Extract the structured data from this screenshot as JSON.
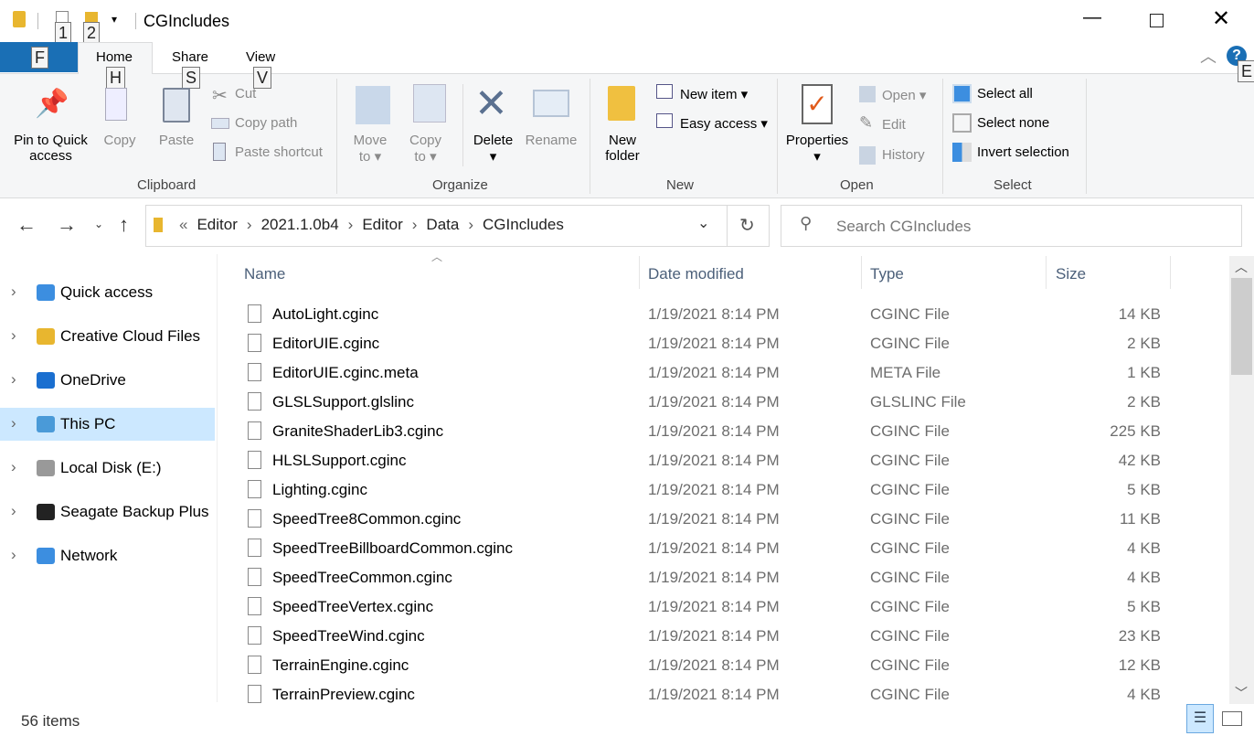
{
  "window": {
    "title": "CGIncludes",
    "qat_keys": [
      "1",
      "2"
    ]
  },
  "tabs": [
    {
      "label": "File",
      "key": "F"
    },
    {
      "label": "Home",
      "key": "H"
    },
    {
      "label": "Share",
      "key": "S"
    },
    {
      "label": "View",
      "key": "V"
    }
  ],
  "help_key": "E",
  "ribbon": {
    "clipboard": {
      "pin": "Pin to Quick access",
      "pin_l1": "Pin to Quick",
      "pin_l2": "access",
      "copy": "Copy",
      "paste": "Paste",
      "cut": "Cut",
      "copy_path": "Copy path",
      "paste_shortcut": "Paste shortcut",
      "group": "Clipboard"
    },
    "organize": {
      "move_l1": "Move",
      "move_l2": "to ▾",
      "copy_l1": "Copy",
      "copy_l2": "to ▾",
      "delete": "Delete",
      "rename": "Rename",
      "group": "Organize"
    },
    "new": {
      "new_item": "New item ▾",
      "easy_access": "Easy access ▾",
      "new_folder_l1": "New",
      "new_folder_l2": "folder",
      "group": "New"
    },
    "open": {
      "properties": "Properties",
      "open": "Open ▾",
      "edit": "Edit",
      "history": "History",
      "group": "Open"
    },
    "select": {
      "select_all": "Select all",
      "select_none": "Select none",
      "invert": "Invert selection",
      "group": "Select"
    }
  },
  "address": {
    "crumbs": [
      "Editor",
      "2021.1.0b4",
      "Editor",
      "Data",
      "CGIncludes"
    ],
    "search_placeholder": "Search CGIncludes"
  },
  "sidebar": [
    {
      "label": "Quick access",
      "icon": "star-icon"
    },
    {
      "label": "Creative Cloud Files",
      "icon": "creative-cloud-icon"
    },
    {
      "label": "OneDrive",
      "icon": "onedrive-icon"
    },
    {
      "label": "This PC",
      "icon": "pc-icon",
      "selected": true
    },
    {
      "label": "Local Disk (E:)",
      "icon": "drive-icon"
    },
    {
      "label": "Seagate Backup Plus",
      "icon": "external-drive-icon"
    },
    {
      "label": "Network",
      "icon": "network-icon"
    }
  ],
  "columns": [
    "Name",
    "Date modified",
    "Type",
    "Size"
  ],
  "files": [
    [
      "AutoLight.cginc",
      "1/19/2021 8:14 PM",
      "CGINC File",
      "14 KB"
    ],
    [
      "EditorUIE.cginc",
      "1/19/2021 8:14 PM",
      "CGINC File",
      "2 KB"
    ],
    [
      "EditorUIE.cginc.meta",
      "1/19/2021 8:14 PM",
      "META File",
      "1 KB"
    ],
    [
      "GLSLSupport.glslinc",
      "1/19/2021 8:14 PM",
      "GLSLINC File",
      "2 KB"
    ],
    [
      "GraniteShaderLib3.cginc",
      "1/19/2021 8:14 PM",
      "CGINC File",
      "225 KB"
    ],
    [
      "HLSLSupport.cginc",
      "1/19/2021 8:14 PM",
      "CGINC File",
      "42 KB"
    ],
    [
      "Lighting.cginc",
      "1/19/2021 8:14 PM",
      "CGINC File",
      "5 KB"
    ],
    [
      "SpeedTree8Common.cginc",
      "1/19/2021 8:14 PM",
      "CGINC File",
      "11 KB"
    ],
    [
      "SpeedTreeBillboardCommon.cginc",
      "1/19/2021 8:14 PM",
      "CGINC File",
      "4 KB"
    ],
    [
      "SpeedTreeCommon.cginc",
      "1/19/2021 8:14 PM",
      "CGINC File",
      "4 KB"
    ],
    [
      "SpeedTreeVertex.cginc",
      "1/19/2021 8:14 PM",
      "CGINC File",
      "5 KB"
    ],
    [
      "SpeedTreeWind.cginc",
      "1/19/2021 8:14 PM",
      "CGINC File",
      "23 KB"
    ],
    [
      "TerrainEngine.cginc",
      "1/19/2021 8:14 PM",
      "CGINC File",
      "12 KB"
    ],
    [
      "TerrainPreview.cginc",
      "1/19/2021 8:14 PM",
      "CGINC File",
      "4 KB"
    ]
  ],
  "status": {
    "items": "56 items"
  },
  "colors": {
    "file_tab": "#1a6fb5",
    "selected": "#cce8ff",
    "accent": "#0078d7"
  }
}
